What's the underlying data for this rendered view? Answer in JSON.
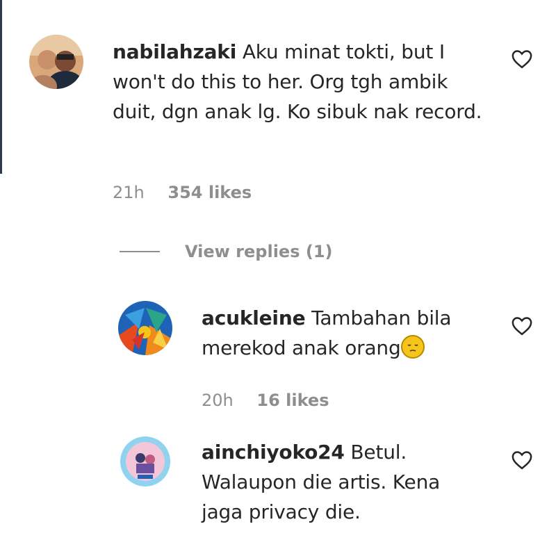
{
  "comments": [
    {
      "username": "nabilahzaki",
      "text": "Aku minat tokti, but I won't do this to her. Org tgh ambik duit, dgn anak lg. Ko sibuk nak record.",
      "time": "21h",
      "likes": "354 likes",
      "view_replies": "View replies (1)"
    }
  ],
  "replies": [
    {
      "username": "acukleine",
      "text": "Tambahan bila merekod anak orang",
      "emoji": "pensive-face-icon",
      "time": "20h",
      "likes": "16 likes"
    },
    {
      "username": "ainchiyoko24",
      "text": "Betul. Walaupon die artis. Kena jaga privacy die."
    }
  ],
  "icons": {
    "heart": "heart-outline-icon"
  },
  "colors": {
    "text": "#262626",
    "muted": "#8e8e8e",
    "background": "#ffffff"
  }
}
